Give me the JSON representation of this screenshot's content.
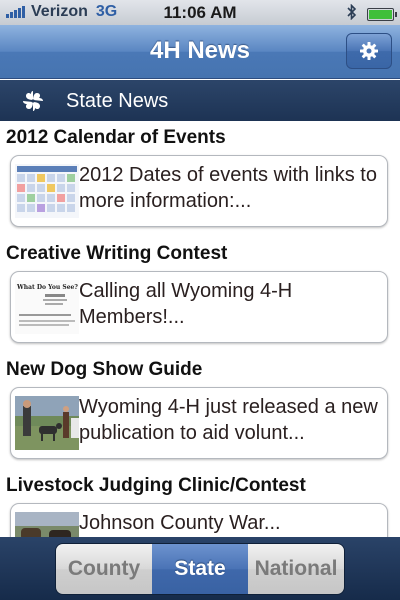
{
  "status_bar": {
    "carrier": "Verizon",
    "network": "3G",
    "time": "11:06 AM",
    "battery_level": 1.0
  },
  "nav": {
    "title": "4H News",
    "settings_icon": "gear-icon"
  },
  "section": {
    "icon": "four-leaf-clover-icon",
    "title": "State News"
  },
  "news": [
    {
      "heading": "2012 Calendar of Events",
      "summary": "2012 Dates of events with links to more information:...",
      "thumbnail": "calendar-thumbnail"
    },
    {
      "heading": "Creative Writing Contest",
      "summary": "Calling all Wyoming 4-H Members!...",
      "thumbnail": "document-thumbnail",
      "thumbnail_text": "What Do You See?"
    },
    {
      "heading": "New Dog Show Guide",
      "summary": "Wyoming 4-H just released a new publication to aid volunt...",
      "thumbnail": "dog-show-photo-thumbnail"
    },
    {
      "heading": "Livestock Judging Clinic/Contest",
      "summary": "Johnson County War...",
      "thumbnail": "livestock-photo-thumbnail"
    }
  ],
  "tabs": [
    {
      "label": "County",
      "selected": false
    },
    {
      "label": "State",
      "selected": true
    },
    {
      "label": "National",
      "selected": false
    }
  ],
  "colors": {
    "nav_blue": "#5a86c2",
    "section_navy": "#233a5c",
    "tab_selected": "#4a73b6"
  }
}
